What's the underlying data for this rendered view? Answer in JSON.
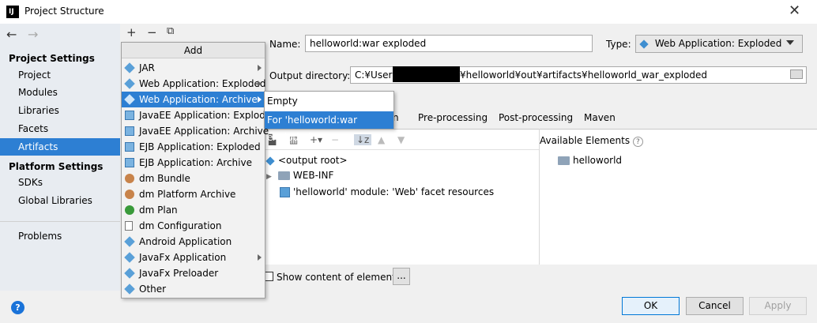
{
  "window": {
    "title": "Project Structure",
    "logo": "IJ"
  },
  "toolbar": {
    "add": "+",
    "remove": "−",
    "copy": "⧉"
  },
  "sidebar": {
    "nav_back": "←",
    "nav_forward": "→",
    "project_settings_header": "Project Settings",
    "project_items": [
      "Project",
      "Modules",
      "Libraries",
      "Facets",
      "Artifacts"
    ],
    "platform_settings_header": "Platform Settings",
    "platform_items": [
      "SDKs",
      "Global Libraries"
    ],
    "problems": "Problems",
    "selected": "Artifacts"
  },
  "artifact": {
    "name_label": "Name:",
    "name_value": "helloworld:war exploded",
    "type_label": "Type:",
    "type_value": "Web Application: Exploded",
    "output_label": "Output directory:",
    "output_prefix": "C:¥Users¥",
    "output_suffix": "¥helloworld¥out¥artifacts¥helloworld_war_exploded"
  },
  "tabs": [
    "n",
    "Pre-processing",
    "Post-processing",
    "Maven"
  ],
  "available_elements_label": "Available Elements",
  "tree": {
    "output_root": "<output root>",
    "web_inf": "WEB-INF",
    "facet_resources": "'helloworld' module: 'Web' facet resources"
  },
  "available": {
    "helloworld": "helloworld"
  },
  "show_content_label": "Show content of elements",
  "ellipsis_button": "...",
  "buttons": {
    "ok": "OK",
    "cancel": "Cancel",
    "apply": "Apply"
  },
  "help": "?",
  "menu": {
    "header": "Add",
    "items": [
      {
        "label": "JAR",
        "icon": "artifact-icon",
        "submenu": true
      },
      {
        "label": "Web Application: Exploded",
        "icon": "web-artifact-icon",
        "submenu": true
      },
      {
        "label": "Web Application: Archive",
        "icon": "web-artifact-icon",
        "submenu": true,
        "highlighted": true
      },
      {
        "label": "JavaEE Application: Exploded",
        "icon": "javaee-icon"
      },
      {
        "label": "JavaEE Application: Archive",
        "icon": "javaee-icon"
      },
      {
        "label": "EJB Application: Exploded",
        "icon": "ejb-icon"
      },
      {
        "label": "EJB Application: Archive",
        "icon": "ejb-icon"
      },
      {
        "label": "dm Bundle",
        "icon": "dm-bundle-icon"
      },
      {
        "label": "dm Platform Archive",
        "icon": "dm-platform-icon"
      },
      {
        "label": "dm Plan",
        "icon": "dm-plan-icon"
      },
      {
        "label": "dm Configuration",
        "icon": "dm-config-icon"
      },
      {
        "label": "Android Application",
        "icon": "android-icon"
      },
      {
        "label": "JavaFx Application",
        "icon": "javafx-icon",
        "submenu": true
      },
      {
        "label": "JavaFx Preloader",
        "icon": "javafx-icon"
      },
      {
        "label": "Other",
        "icon": "artifact-icon"
      }
    ]
  },
  "submenu": {
    "items": [
      "Empty",
      "For 'helloworld:war exploded'"
    ],
    "highlighted_index": 1
  },
  "colors": {
    "selection": "#2d7fd3",
    "sidebar_bg": "#e8ecf1",
    "dialog_bg": "#f0f0f0"
  }
}
